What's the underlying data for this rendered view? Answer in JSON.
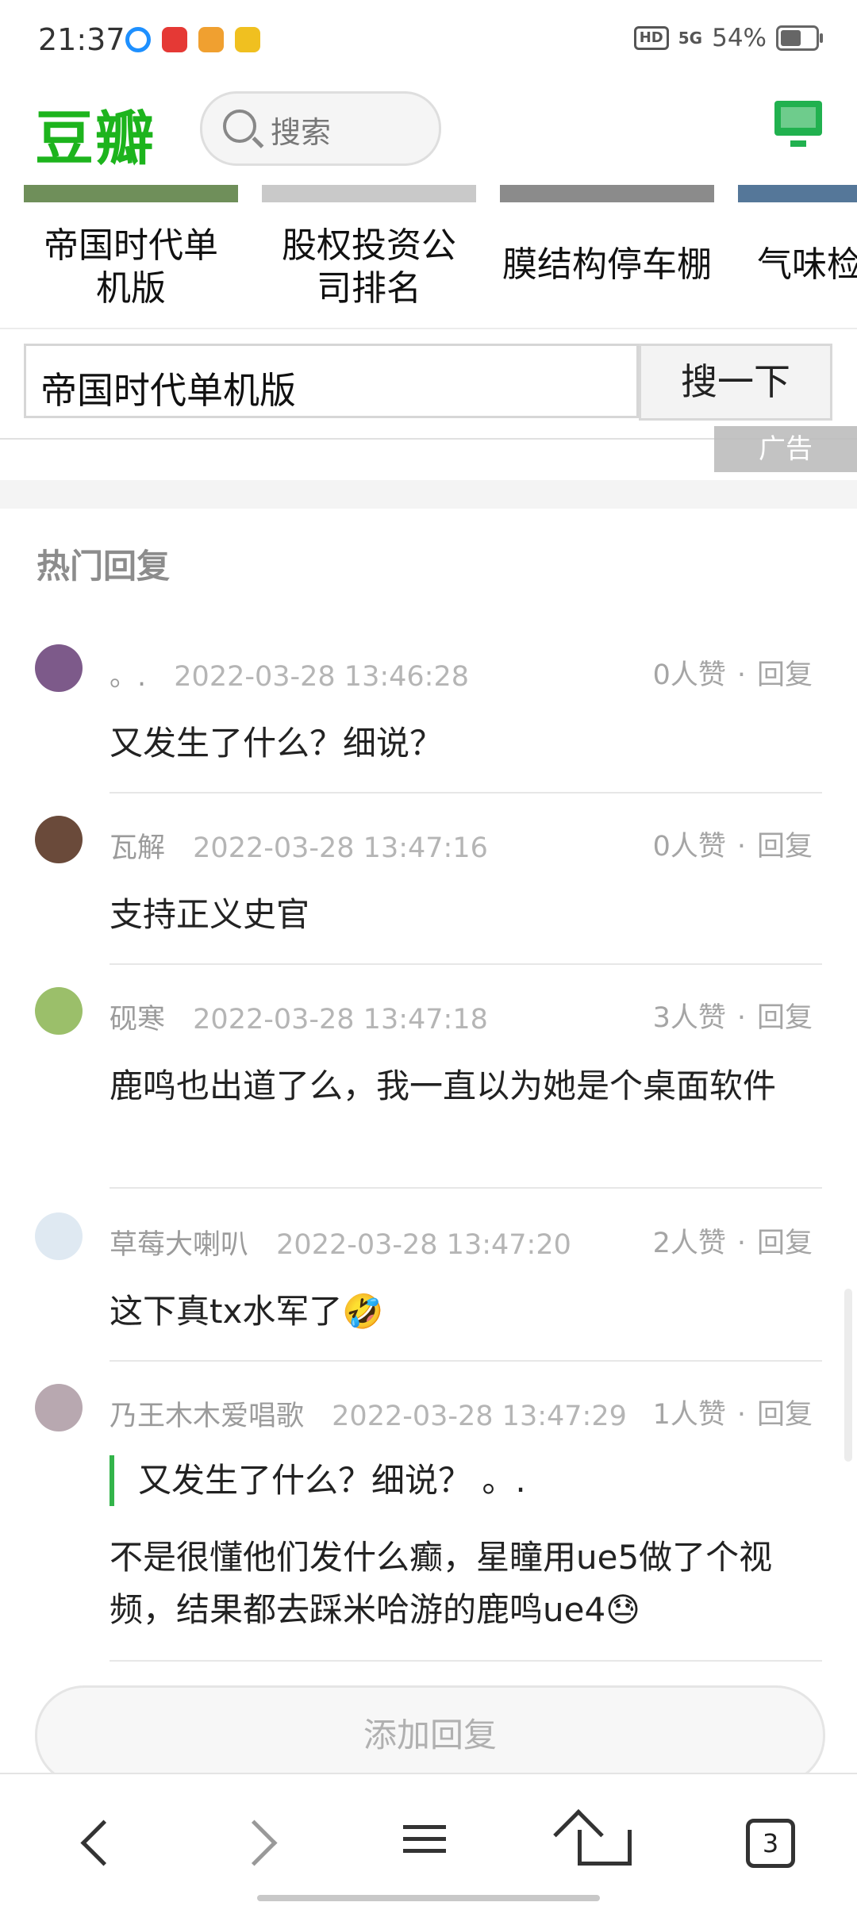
{
  "status_bar": {
    "time": "21:37",
    "hd": "HD",
    "network": "5G",
    "battery": "54%"
  },
  "header": {
    "logo": "豆瓣",
    "search_placeholder": "搜索"
  },
  "suggestions": [
    "帝国时代单机版",
    "股权投资公司排名",
    "膜结构停车棚",
    "气味检"
  ],
  "ad": {
    "query": "帝国时代单机版",
    "button": "搜一下",
    "tag": "广告"
  },
  "section_title": "热门回复",
  "comments": [
    {
      "name": "。.",
      "time": "2022-03-28 13:46:28",
      "likes": "0人赞",
      "reply": "回复",
      "text": "又发生了什么？细说？"
    },
    {
      "name": "瓦解",
      "time": "2022-03-28 13:47:16",
      "likes": "0人赞",
      "reply": "回复",
      "text": "支持正义史官"
    },
    {
      "name": "砚寒",
      "time": "2022-03-28 13:47:18",
      "likes": "3人赞",
      "reply": "回复",
      "text": "鹿鸣也出道了么，我一直以为她是个桌面软件"
    },
    {
      "name": "草莓大喇叭",
      "time": "2022-03-28 13:47:20",
      "likes": "2人赞",
      "reply": "回复",
      "text": "这下真tx水军了🤣"
    },
    {
      "name": "乃王木木爱唱歌",
      "time": "2022-03-28 13:47:29",
      "likes": "1人赞",
      "reply": "回复",
      "quote": "又发生了什么？细说？ 。.",
      "text": "不是很懂他们发什么癫，星瞳用ue5做了个视频，结果都去踩米哈游的鹿鸣ue4😓"
    }
  ],
  "add_reply": "添加回复",
  "nav": {
    "tabs_count": "3"
  },
  "colors": {
    "brand": "#1db41d",
    "quote_bar": "#33b44a"
  }
}
